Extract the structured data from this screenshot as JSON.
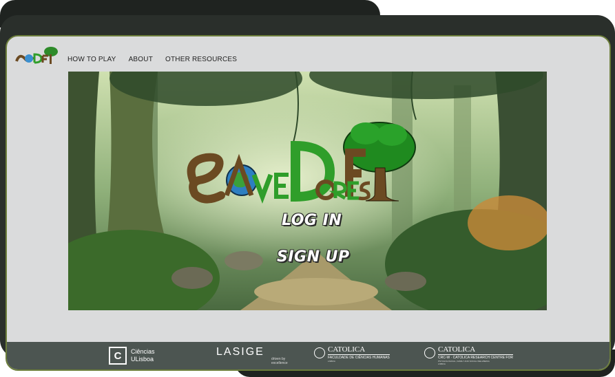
{
  "nav": {
    "items": [
      "HOW TO PLAY",
      "ABOUT",
      "OTHER RESOURCES"
    ]
  },
  "hero": {
    "login_label": "LOG IN",
    "signup_label": "SIGN UP"
  },
  "footer": {
    "ciencias": {
      "line1": "Ciências",
      "line2": "ULisboa",
      "mark": "C"
    },
    "lasige": {
      "name": "LASIGE",
      "tagline1": "driven by",
      "tagline2": "excellence"
    },
    "catolica1": {
      "name": "CATOLICA",
      "faculty": "FACULDADE DE CIÊNCIAS HUMANAS",
      "city": "LISBOA"
    },
    "catolica2": {
      "name": "CATOLICA",
      "centre": "CRC-W · CATOLICA RESEARCH CENTRE FOR",
      "centre2": "PSYCHOLOGICAL, FAMILY AND SOCIAL WELLBEING",
      "city": "LISBOA"
    }
  },
  "colors": {
    "screen_bg": "#dadbdc",
    "footer_bg": "#4c5551",
    "device_frame": "#2a2f2b",
    "brand_green": "#2f9e2a",
    "brand_brown": "#6b4a22"
  }
}
